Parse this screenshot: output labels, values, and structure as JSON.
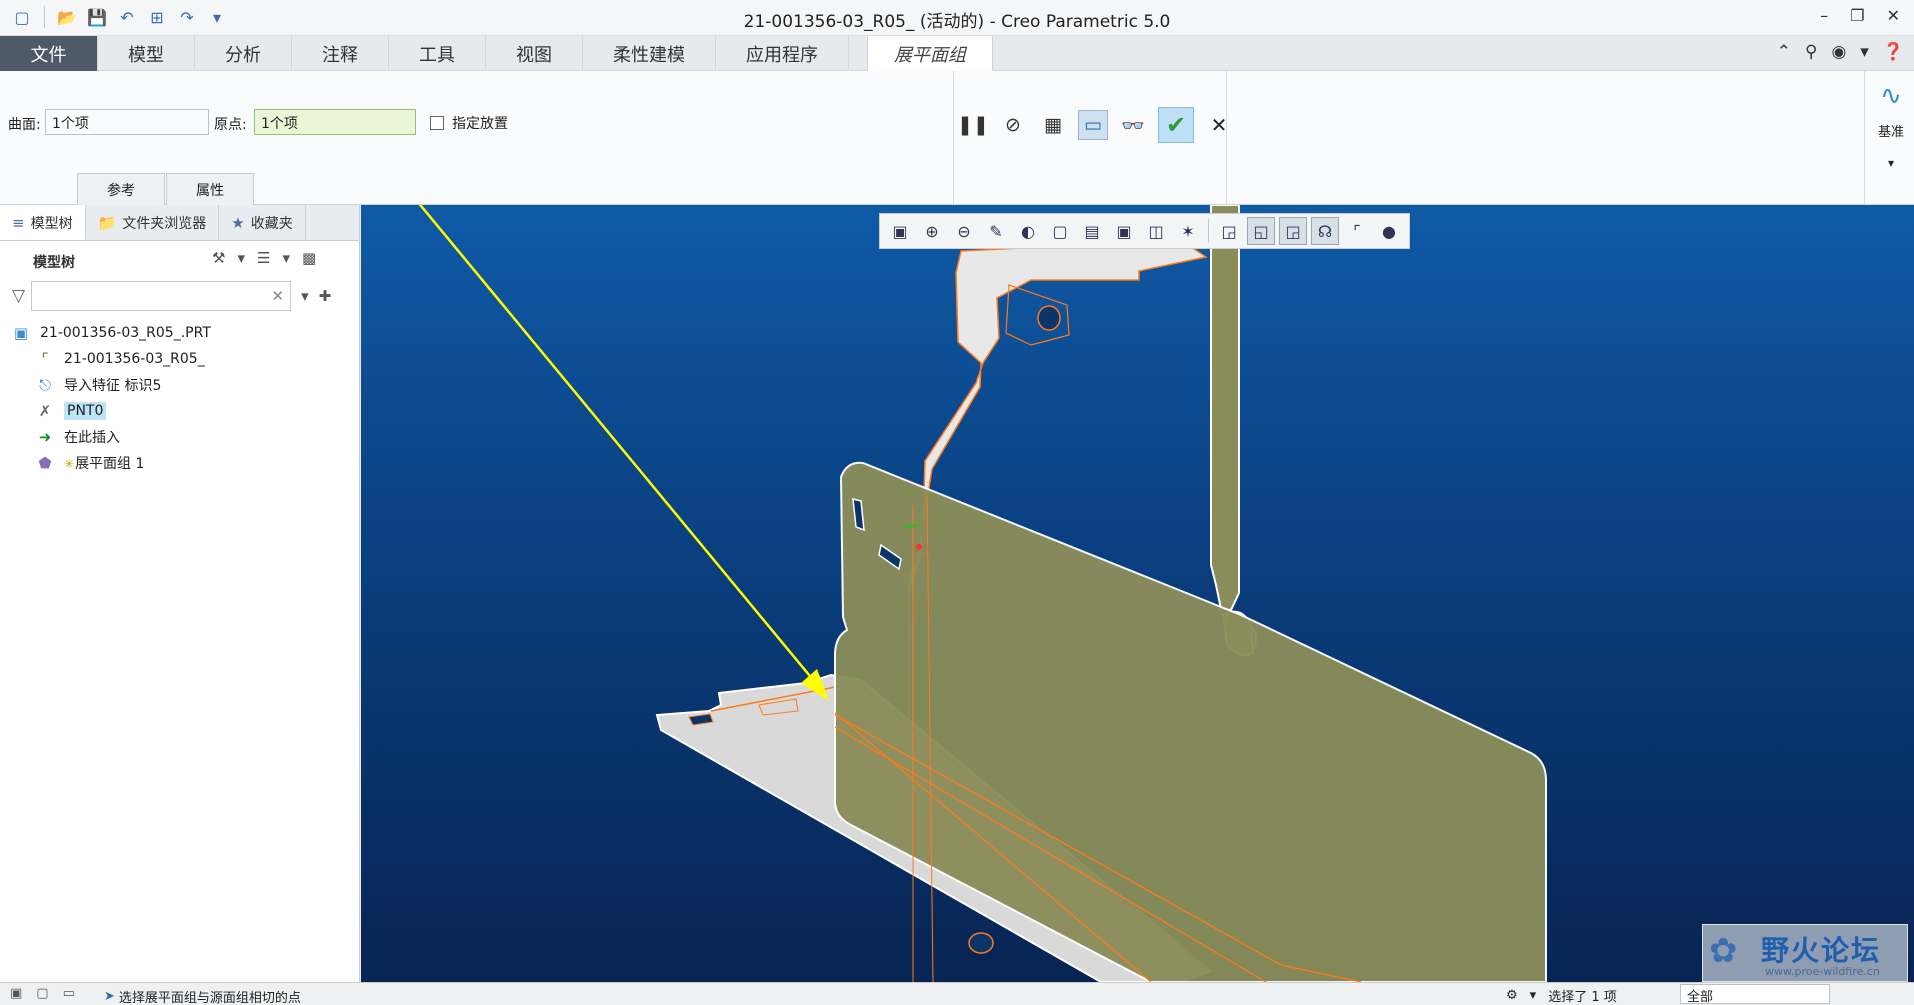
{
  "window": {
    "title": "21-001356-03_R05_ (活动的) - Creo Parametric 5.0"
  },
  "ribbon_tabs": [
    {
      "label": "文件"
    },
    {
      "label": "模型"
    },
    {
      "label": "分析"
    },
    {
      "label": "注释"
    },
    {
      "label": "工具"
    },
    {
      "label": "视图"
    },
    {
      "label": "柔性建模"
    },
    {
      "label": "应用程序"
    }
  ],
  "active_tab": {
    "label": "展平面组"
  },
  "ribbon": {
    "surface_label": "曲面:",
    "surface_value": "1个项",
    "origin_label": "原点:",
    "origin_value": "1个项",
    "specify_placement_label": "指定放置",
    "sub_tabs": [
      "参考",
      "属性"
    ],
    "datum_label": "基准"
  },
  "navigator": {
    "tabs": [
      "模型树",
      "文件夹浏览器",
      "收藏夹"
    ],
    "tree_header": "模型树",
    "items": [
      {
        "label": "21-001356-03_R05_.PRT"
      },
      {
        "label": "21-001356-03_R05_"
      },
      {
        "label": "导入特征 标识5"
      },
      {
        "label": "PNT0"
      },
      {
        "label": "在此插入"
      },
      {
        "label": "展平面组 1"
      }
    ]
  },
  "watermark": {
    "text": "野火论坛",
    "url": "www.proe-wildfire.cn"
  },
  "statusbar": {
    "message": "选择展平面组与源面组相切的点",
    "selection": "选择了 1 项",
    "filter": "全部"
  },
  "colors": {
    "file_tab": "#4f5a66",
    "viewport_top": "#0f5aa6",
    "viewport_bottom": "#072452",
    "part_surface": "#8a8d5a",
    "edge_highlight": "#ff7a1a",
    "arrow": "#ffff00"
  }
}
